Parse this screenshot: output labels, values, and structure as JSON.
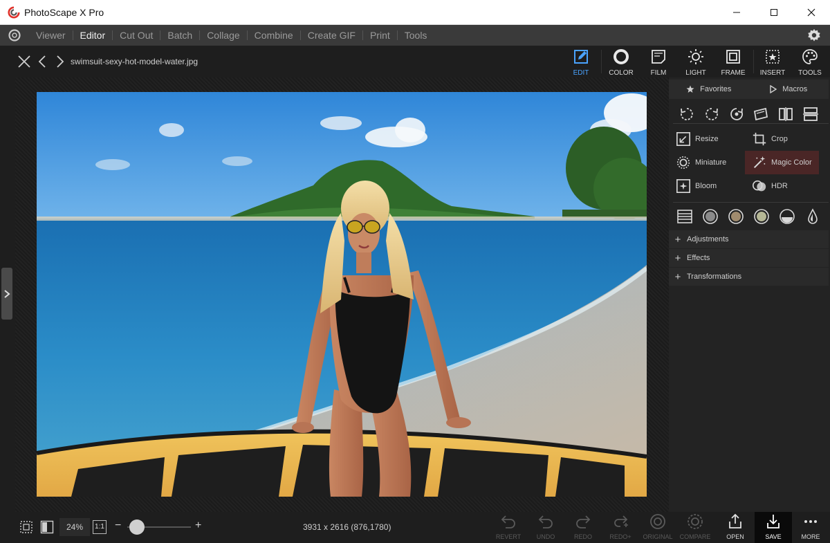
{
  "window": {
    "title": "PhotoScape X Pro"
  },
  "menu": {
    "items": [
      "Viewer",
      "Editor",
      "Cut Out",
      "Batch",
      "Collage",
      "Combine",
      "Create GIF",
      "Print",
      "Tools"
    ],
    "active": "Editor"
  },
  "header": {
    "filename": "swimsuit-sexy-hot-model-water.jpg",
    "tabs": [
      {
        "label": "EDIT",
        "icon": "edit-icon"
      },
      {
        "label": "COLOR",
        "icon": "color-icon"
      },
      {
        "label": "FILM",
        "icon": "film-icon"
      },
      {
        "label": "LIGHT",
        "icon": "light-icon"
      },
      {
        "label": "FRAME",
        "icon": "frame-icon"
      },
      {
        "label": "INSERT",
        "icon": "insert-icon"
      },
      {
        "label": "TOOLS",
        "icon": "palette-icon"
      }
    ],
    "active_tab": "EDIT"
  },
  "panel": {
    "favorites": "Favorites",
    "macros": "Macros",
    "tools": [
      {
        "label": "Resize",
        "icon": "resize-icon"
      },
      {
        "label": "Crop",
        "icon": "crop-icon"
      },
      {
        "label": "Miniature",
        "icon": "miniature-icon"
      },
      {
        "label": "Magic Color",
        "icon": "magic-wand-icon"
      },
      {
        "label": "Bloom",
        "icon": "bloom-icon"
      },
      {
        "label": "HDR",
        "icon": "hdr-icon"
      }
    ],
    "highlighted_tool": "Magic Color",
    "sections": [
      "Adjustments",
      "Effects",
      "Transformations"
    ]
  },
  "bottom": {
    "zoom": "24%",
    "one_to_one": "1:1",
    "minus": "−",
    "plus": "+",
    "zoom_level": 0.24,
    "image_info": "3931 x 2616 (876,1780)",
    "actions": [
      {
        "label": "REVERT",
        "enabled": false,
        "icon": "revert-icon"
      },
      {
        "label": "UNDO",
        "enabled": false,
        "icon": "undo-icon"
      },
      {
        "label": "REDO",
        "enabled": false,
        "icon": "redo-icon"
      },
      {
        "label": "REDO+",
        "enabled": false,
        "icon": "redo-plus-icon"
      },
      {
        "label": "ORIGINAL",
        "enabled": false,
        "icon": "original-icon"
      },
      {
        "label": "COMPARE",
        "enabled": false,
        "icon": "compare-icon"
      },
      {
        "label": "OPEN",
        "enabled": true,
        "icon": "share-icon"
      },
      {
        "label": "SAVE",
        "enabled": true,
        "icon": "save-icon"
      },
      {
        "label": "MORE",
        "enabled": true,
        "icon": "more-icon"
      }
    ]
  },
  "colors": {
    "accent": "#4aa3ff",
    "highlight": "#4a2626",
    "menubar": "#3a3a3a",
    "background": "#1e1e1e"
  }
}
